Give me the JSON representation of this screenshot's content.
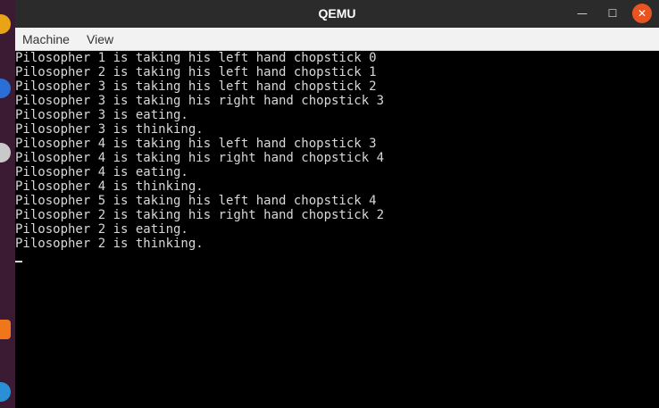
{
  "window": {
    "title": "QEMU",
    "minimize_glyph": "—",
    "maximize_glyph": "☐",
    "close_glyph": "✕"
  },
  "menubar": {
    "items": [
      "Machine",
      "View"
    ]
  },
  "console": {
    "lines": [
      "Pilosopher 1 is taking his left hand chopstick 0",
      "Pilosopher 2 is taking his left hand chopstick 1",
      "Pilosopher 3 is taking his left hand chopstick 2",
      "Pilosopher 3 is taking his right hand chopstick 3",
      "Pilosopher 3 is eating.",
      "Pilosopher 3 is thinking.",
      "Pilosopher 4 is taking his left hand chopstick 3",
      "Pilosopher 4 is taking his right hand chopstick 4",
      "Pilosopher 4 is eating.",
      "Pilosopher 4 is thinking.",
      "Pilosopher 5 is taking his left hand chopstick 4",
      "Pilosopher 2 is taking his right hand chopstick 2",
      "Pilosopher 2 is eating.",
      "Pilosopher 2 is thinking."
    ]
  },
  "colors": {
    "titlebar_bg": "#2b2b2b",
    "close_button": "#e95420",
    "console_bg": "#000000",
    "console_fg": "#d8d8d8",
    "dock_bg": "#3b1a34"
  }
}
